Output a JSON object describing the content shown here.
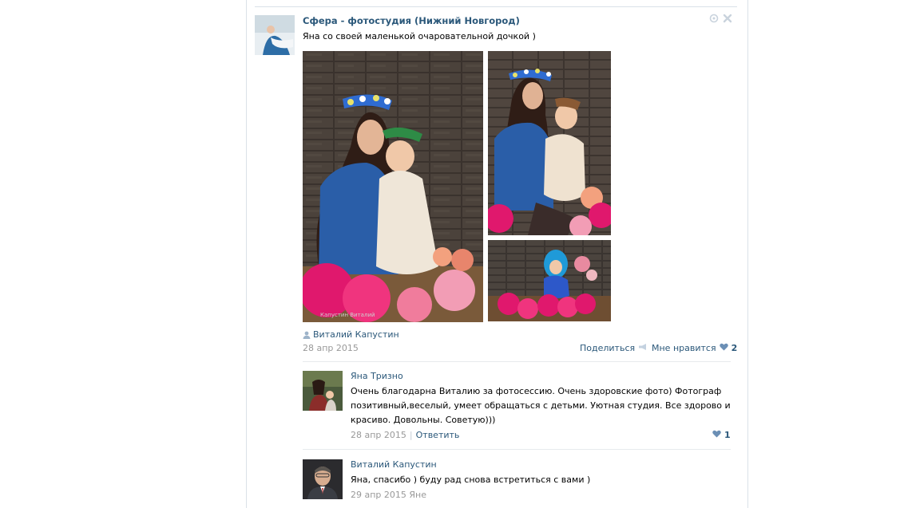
{
  "post": {
    "author": "Сфера - фотостудия (Нижний Новгород)",
    "text": "Яна со своей маленькой очаровательной дочкой )",
    "signer": "Виталий Капустин",
    "date": "28 апр 2015",
    "share_label": "Поделиться",
    "like_label": "Мне нравится",
    "like_count": "2",
    "watermark": "Капустин Виталий"
  },
  "comments": [
    {
      "author": "Яна Тризно",
      "text": "Очень благодарна Виталию за фотосессию. Очень здоровские фото) Фотограф позитивный,веселый, умеет обращаться с детьми. Уютная студия. Все здорово и красиво. Довольны. Советую)))",
      "date": "28 апр 2015",
      "reply_label": "Ответить",
      "like_count": "1"
    },
    {
      "author": "Виталий Капустин",
      "text": "Яна, спасибо ) буду рад снова встретиться с вами )",
      "date": "29 апр 2015 Яне"
    }
  ],
  "colors": {
    "link": "#2b587a",
    "muted": "#999999",
    "heart": "#6b8fb5",
    "border": "#dae1e8"
  },
  "icons": [
    "user-icon",
    "megaphone-icon",
    "heart-icon",
    "close-icon",
    "settings-icon"
  ]
}
